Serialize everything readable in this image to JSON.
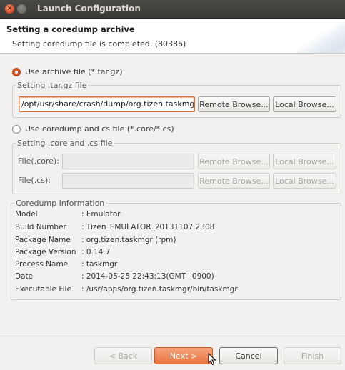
{
  "window": {
    "title": "Launch Configuration"
  },
  "banner": {
    "title": "Setting a coredump archive",
    "message": "Setting coredump file is completed. (80386)"
  },
  "archive_option": {
    "label": "Use archive file (*.tar.gz)",
    "selected": true,
    "group_title": "Setting .tar.gz file",
    "path_value": "/opt/usr/share/crash/dump/org.tizen.taskmgr",
    "remote_browse": "Remote Browse...",
    "local_browse": "Local Browse..."
  },
  "coredump_option": {
    "label": "Use coredump and cs file (*.core/*.cs)",
    "selected": false,
    "group_title": "Setting .core and .cs file",
    "core_label": "File(.core):",
    "cs_label": "File(.cs):",
    "remote_browse": "Remote Browse...",
    "local_browse": "Local Browse..."
  },
  "info": {
    "group_title": "Coredump Information",
    "rows": [
      {
        "key": "Model",
        "value": ": Emulator"
      },
      {
        "key": "Build Number",
        "value": ": Tizen_EMULATOR_20131107.2308"
      },
      {
        "key": "Package Name",
        "value": ": org.tizen.taskmgr (rpm)"
      },
      {
        "key": "Package Version",
        "value": ": 0.14.7"
      },
      {
        "key": "Process Name",
        "value": ": taskmgr"
      },
      {
        "key": "Date",
        "value": ": 2014-05-25 22:43:13(GMT+0900)"
      },
      {
        "key": "Executable File",
        "value": ": /usr/apps/org.tizen.taskmgr/bin/taskmgr"
      }
    ]
  },
  "footer": {
    "back": "< Back",
    "next": "Next >",
    "cancel": "Cancel",
    "finish": "Finish"
  },
  "colors": {
    "accent": "#e8743f",
    "titlebar": "#3c3b37"
  }
}
